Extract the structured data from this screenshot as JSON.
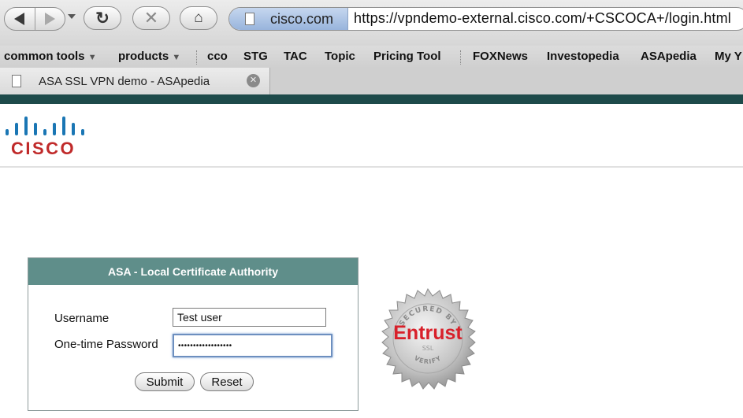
{
  "browser": {
    "site_identity": "cisco.com",
    "url": "https://vpndemo-external.cisco.com/+CSCOCA+/login.html",
    "bookmarks": [
      {
        "label": "common tools",
        "dropdown": true
      },
      {
        "label": "products",
        "dropdown": true
      },
      {
        "label": "cco"
      },
      {
        "label": "STG"
      },
      {
        "label": "TAC"
      },
      {
        "label": "Topic"
      },
      {
        "label": "Pricing Tool"
      },
      {
        "label": "FOXNews"
      },
      {
        "label": "Investopedia"
      },
      {
        "label": "ASApedia"
      },
      {
        "label": "My Y"
      }
    ],
    "tab": {
      "title": "ASA SSL VPN demo - ASApedia"
    },
    "icons": {
      "back": "back-arrow-icon",
      "forward": "forward-arrow-icon",
      "reload": "reload-icon",
      "stop": "stop-icon",
      "home": "home-icon",
      "close_tab": "close-icon"
    },
    "colors": {
      "chrome_accent": "#1d4a4a"
    }
  },
  "page": {
    "logo": {
      "text": "CISCO",
      "color": "#c02a2a",
      "bars_color": "#1a76b4"
    },
    "login": {
      "title": "ASA - Local Certificate Authority",
      "username_label": "Username",
      "username_value": "Test user",
      "password_label": "One-time Password",
      "password_value": "••••••••••••••••••",
      "submit_label": "Submit",
      "reset_label": "Reset",
      "header_color": "#5f8e8a"
    },
    "seal": {
      "brand": "Entrust",
      "top_text": "SECURED BY",
      "middle_text": "SSL",
      "bottom_text": "VERIFY"
    }
  }
}
